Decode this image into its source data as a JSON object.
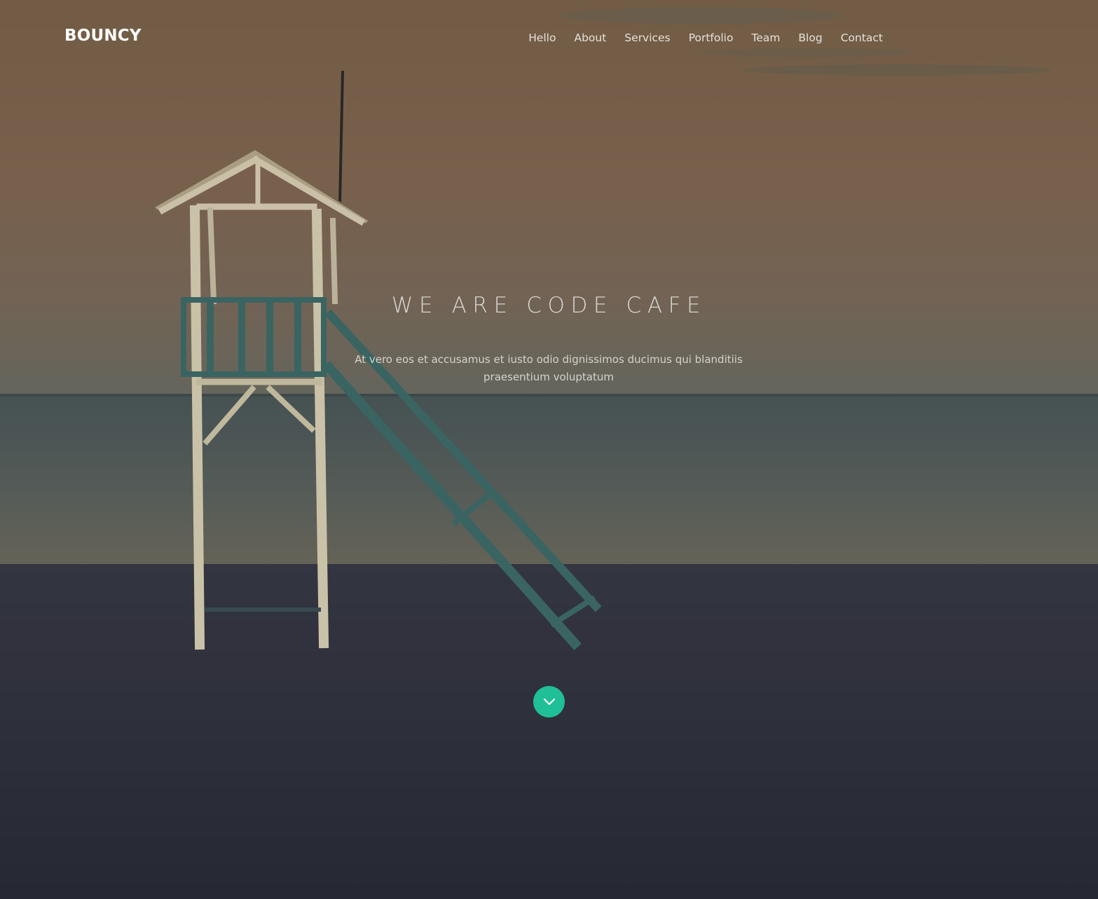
{
  "brand": {
    "name": "BOUNCY"
  },
  "nav": {
    "items": [
      {
        "label": "Hello"
      },
      {
        "label": "About"
      },
      {
        "label": "Services"
      },
      {
        "label": "Portfolio"
      },
      {
        "label": "Team"
      },
      {
        "label": "Blog"
      },
      {
        "label": "Contact"
      }
    ]
  },
  "hero": {
    "title": "WE ARE CODE CAFE",
    "subtitle": "At vero eos et accusamus et iusto odio dignissimos ducimus qui blanditiis praesentium voluptatum",
    "background": "beach-lifeguard-tower-photo",
    "scroll_icon": "chevron-down-icon"
  },
  "colors": {
    "accent": "#1fbf98",
    "text_light": "#ffffff",
    "sky": "#7e6a50",
    "sea": "#5f6662",
    "sand": "#2d2f3b"
  }
}
